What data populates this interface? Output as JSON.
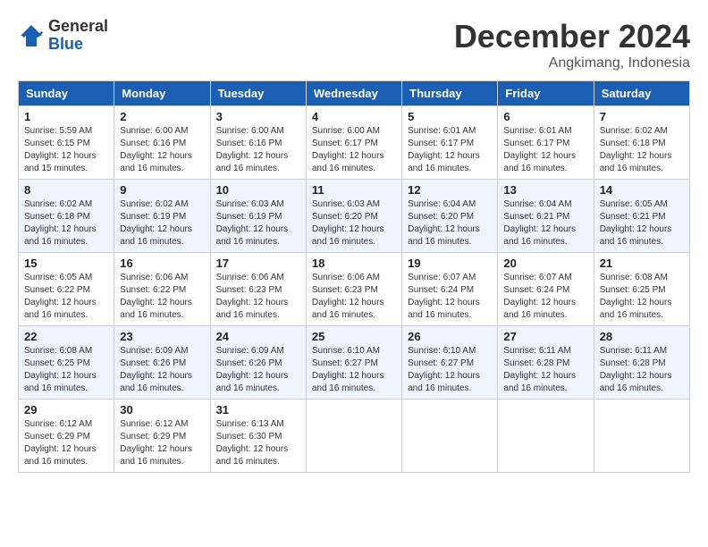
{
  "header": {
    "logo": {
      "text_general": "General",
      "text_blue": "Blue"
    },
    "title": "December 2024",
    "location": "Angkimang, Indonesia"
  },
  "days_of_week": [
    "Sunday",
    "Monday",
    "Tuesday",
    "Wednesday",
    "Thursday",
    "Friday",
    "Saturday"
  ],
  "weeks": [
    [
      {
        "day": 1,
        "sunrise": "5:59 AM",
        "sunset": "6:15 PM",
        "daylight": "12 hours and 15 minutes."
      },
      {
        "day": 2,
        "sunrise": "6:00 AM",
        "sunset": "6:16 PM",
        "daylight": "12 hours and 16 minutes."
      },
      {
        "day": 3,
        "sunrise": "6:00 AM",
        "sunset": "6:16 PM",
        "daylight": "12 hours and 16 minutes."
      },
      {
        "day": 4,
        "sunrise": "6:00 AM",
        "sunset": "6:17 PM",
        "daylight": "12 hours and 16 minutes."
      },
      {
        "day": 5,
        "sunrise": "6:01 AM",
        "sunset": "6:17 PM",
        "daylight": "12 hours and 16 minutes."
      },
      {
        "day": 6,
        "sunrise": "6:01 AM",
        "sunset": "6:17 PM",
        "daylight": "12 hours and 16 minutes."
      },
      {
        "day": 7,
        "sunrise": "6:02 AM",
        "sunset": "6:18 PM",
        "daylight": "12 hours and 16 minutes."
      }
    ],
    [
      {
        "day": 8,
        "sunrise": "6:02 AM",
        "sunset": "6:18 PM",
        "daylight": "12 hours and 16 minutes."
      },
      {
        "day": 9,
        "sunrise": "6:02 AM",
        "sunset": "6:19 PM",
        "daylight": "12 hours and 16 minutes."
      },
      {
        "day": 10,
        "sunrise": "6:03 AM",
        "sunset": "6:19 PM",
        "daylight": "12 hours and 16 minutes."
      },
      {
        "day": 11,
        "sunrise": "6:03 AM",
        "sunset": "6:20 PM",
        "daylight": "12 hours and 16 minutes."
      },
      {
        "day": 12,
        "sunrise": "6:04 AM",
        "sunset": "6:20 PM",
        "daylight": "12 hours and 16 minutes."
      },
      {
        "day": 13,
        "sunrise": "6:04 AM",
        "sunset": "6:21 PM",
        "daylight": "12 hours and 16 minutes."
      },
      {
        "day": 14,
        "sunrise": "6:05 AM",
        "sunset": "6:21 PM",
        "daylight": "12 hours and 16 minutes."
      }
    ],
    [
      {
        "day": 15,
        "sunrise": "6:05 AM",
        "sunset": "6:22 PM",
        "daylight": "12 hours and 16 minutes."
      },
      {
        "day": 16,
        "sunrise": "6:06 AM",
        "sunset": "6:22 PM",
        "daylight": "12 hours and 16 minutes."
      },
      {
        "day": 17,
        "sunrise": "6:06 AM",
        "sunset": "6:23 PM",
        "daylight": "12 hours and 16 minutes."
      },
      {
        "day": 18,
        "sunrise": "6:06 AM",
        "sunset": "6:23 PM",
        "daylight": "12 hours and 16 minutes."
      },
      {
        "day": 19,
        "sunrise": "6:07 AM",
        "sunset": "6:24 PM",
        "daylight": "12 hours and 16 minutes."
      },
      {
        "day": 20,
        "sunrise": "6:07 AM",
        "sunset": "6:24 PM",
        "daylight": "12 hours and 16 minutes."
      },
      {
        "day": 21,
        "sunrise": "6:08 AM",
        "sunset": "6:25 PM",
        "daylight": "12 hours and 16 minutes."
      }
    ],
    [
      {
        "day": 22,
        "sunrise": "6:08 AM",
        "sunset": "6:25 PM",
        "daylight": "12 hours and 16 minutes."
      },
      {
        "day": 23,
        "sunrise": "6:09 AM",
        "sunset": "6:26 PM",
        "daylight": "12 hours and 16 minutes."
      },
      {
        "day": 24,
        "sunrise": "6:09 AM",
        "sunset": "6:26 PM",
        "daylight": "12 hours and 16 minutes."
      },
      {
        "day": 25,
        "sunrise": "6:10 AM",
        "sunset": "6:27 PM",
        "daylight": "12 hours and 16 minutes."
      },
      {
        "day": 26,
        "sunrise": "6:10 AM",
        "sunset": "6:27 PM",
        "daylight": "12 hours and 16 minutes."
      },
      {
        "day": 27,
        "sunrise": "6:11 AM",
        "sunset": "6:28 PM",
        "daylight": "12 hours and 16 minutes."
      },
      {
        "day": 28,
        "sunrise": "6:11 AM",
        "sunset": "6:28 PM",
        "daylight": "12 hours and 16 minutes."
      }
    ],
    [
      {
        "day": 29,
        "sunrise": "6:12 AM",
        "sunset": "6:29 PM",
        "daylight": "12 hours and 16 minutes."
      },
      {
        "day": 30,
        "sunrise": "6:12 AM",
        "sunset": "6:29 PM",
        "daylight": "12 hours and 16 minutes."
      },
      {
        "day": 31,
        "sunrise": "6:13 AM",
        "sunset": "6:30 PM",
        "daylight": "12 hours and 16 minutes."
      },
      null,
      null,
      null,
      null
    ]
  ],
  "labels": {
    "sunrise": "Sunrise:",
    "sunset": "Sunset:",
    "daylight": "Daylight:"
  }
}
